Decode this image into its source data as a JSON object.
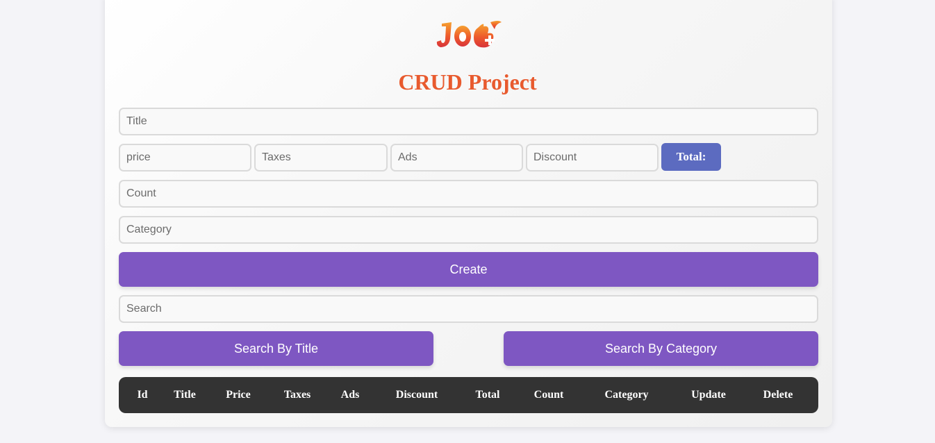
{
  "app": {
    "title": "CRUD Project",
    "accent_color": "#e85a2e",
    "button_color": "#7e57c2",
    "total_color": "#5c6bc0"
  },
  "logo": {
    "icon": "flame-logo-icon"
  },
  "form": {
    "title_placeholder": "Title",
    "price_placeholder": "price",
    "taxes_placeholder": "Taxes",
    "ads_placeholder": "Ads",
    "discount_placeholder": "Discount",
    "total_label": "Total:",
    "count_placeholder": "Count",
    "category_placeholder": "Category",
    "create_label": "Create"
  },
  "search": {
    "placeholder": "Search",
    "by_title_label": "Search By Title",
    "by_category_label": "Search By Category"
  },
  "table": {
    "columns": [
      "Id",
      "Title",
      "Price",
      "Taxes",
      "Ads",
      "Discount",
      "Total",
      "Count",
      "Category",
      "Update",
      "Delete"
    ],
    "rows": []
  }
}
